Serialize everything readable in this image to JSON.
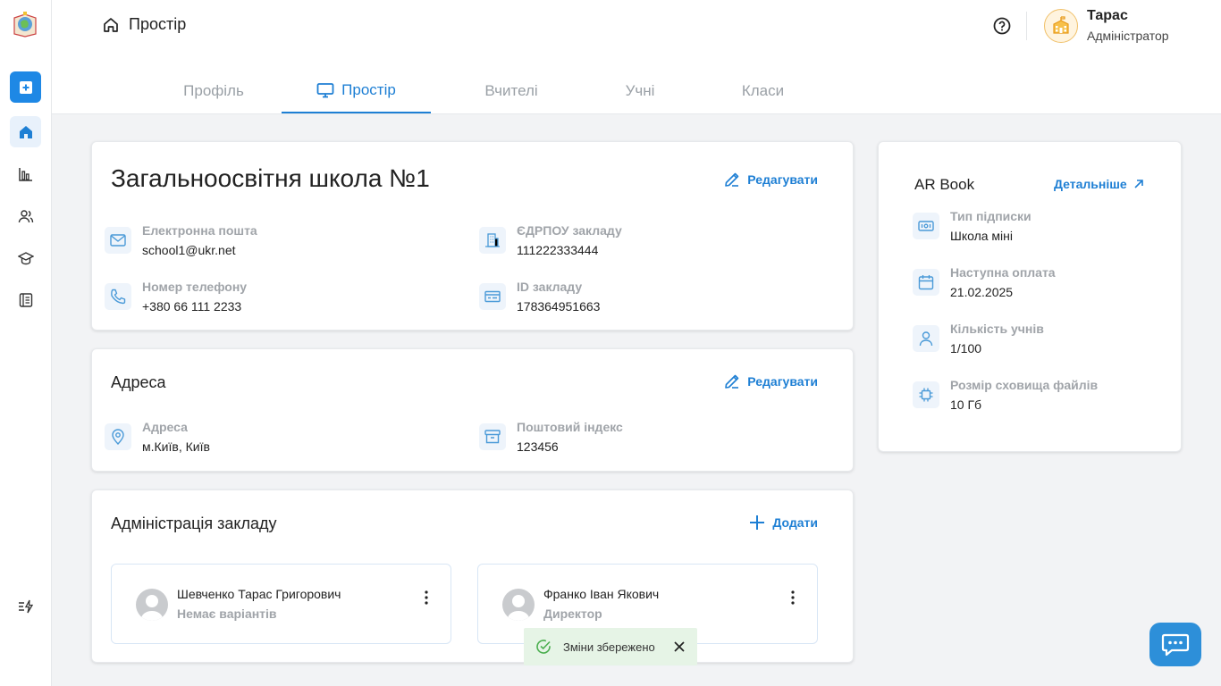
{
  "header": {
    "breadcrumb": "Простір",
    "user": {
      "name": "Тарас",
      "role": "Адміністратор"
    }
  },
  "tabs": [
    {
      "label": "Профіль",
      "active": false
    },
    {
      "label": "Простір",
      "active": true
    },
    {
      "label": "Вчителі",
      "active": false
    },
    {
      "label": "Учні",
      "active": false
    },
    {
      "label": "Класи",
      "active": false
    }
  ],
  "school": {
    "title": "Загальноосвітня школа №1",
    "edit_label": "Редагувати",
    "fields": [
      {
        "label": "Електронна пошта",
        "value": "school1@ukr.net",
        "icon": "mail-icon"
      },
      {
        "label": "ЄДРПОУ закладу",
        "value": "111222333444",
        "icon": "building-icon"
      },
      {
        "label": "Номер телефону",
        "value": "+380 66 111 2233",
        "icon": "phone-icon"
      },
      {
        "label": "ID закладу",
        "value": "178364951663",
        "icon": "id-card-icon"
      }
    ]
  },
  "address": {
    "title": "Адреса",
    "edit_label": "Редагувати",
    "fields": [
      {
        "label": "Адреса",
        "value": "м.Київ, Київ",
        "icon": "location-icon"
      },
      {
        "label": "Поштовий індекс",
        "value": "123456",
        "icon": "archive-icon"
      }
    ]
  },
  "admin": {
    "title": "Адміністрація закладу",
    "add_label": "Додати",
    "people": [
      {
        "name": "Шевченко Тарас Григорович",
        "role": "Немає варіантів"
      },
      {
        "name": "Франко Іван Якович",
        "role": "Директор"
      }
    ]
  },
  "book": {
    "title": "AR Book",
    "link_label": "Детальніше",
    "fields": [
      {
        "label": "Тип підписки",
        "value": "Школа міні",
        "icon": "subscription-icon"
      },
      {
        "label": "Наступна оплата",
        "value": "21.02.2025",
        "icon": "calendar-icon"
      },
      {
        "label": "Кількість учнів",
        "value": "1/100",
        "icon": "user-icon"
      },
      {
        "label": "Розмір сховища файлів",
        "value": "10 Гб",
        "icon": "chip-icon"
      }
    ]
  },
  "toast": {
    "text": "Зміни збережено"
  },
  "colors": {
    "accent": "#1e7fd4",
    "primary_button": "#1e88e5",
    "toast_bg": "#e6f4e6",
    "success": "#4caf50"
  }
}
